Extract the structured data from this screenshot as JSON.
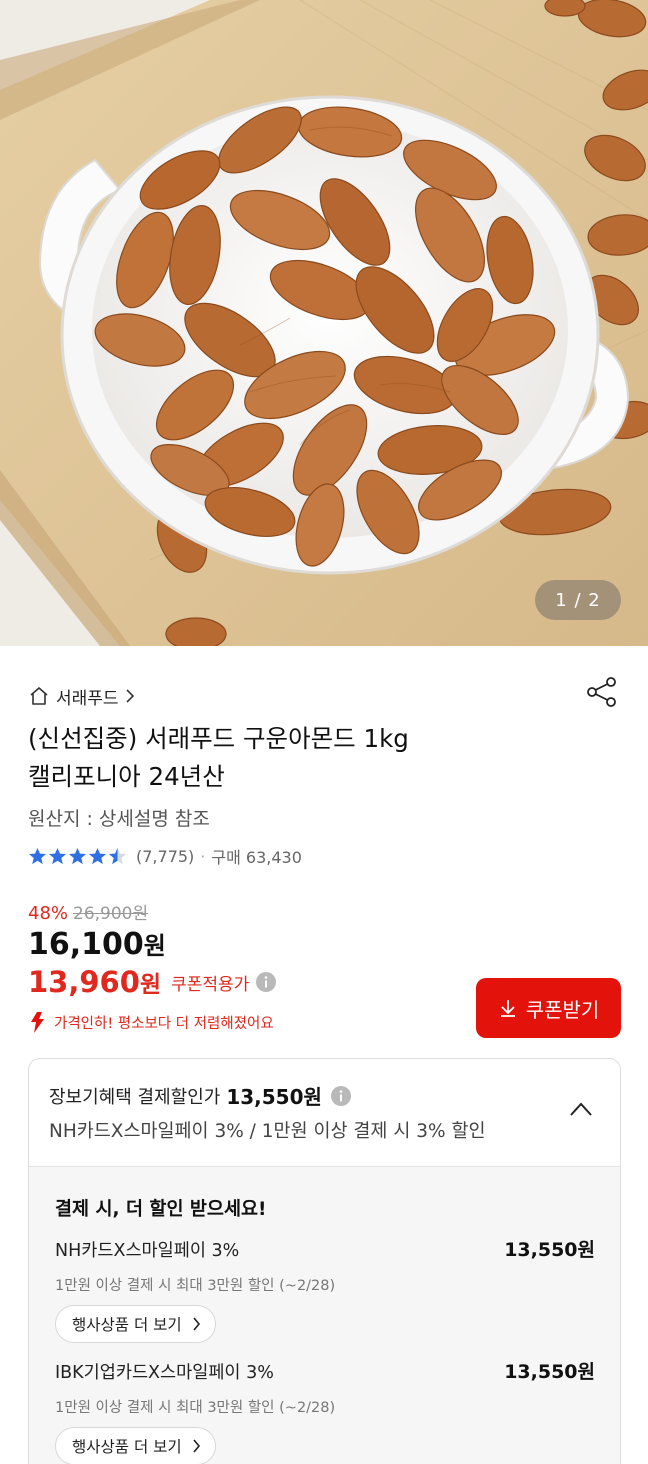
{
  "gallery": {
    "page_indicator": "1 / 2"
  },
  "product": {
    "seller": "서래푸드",
    "title_line1": "(신선집중) 서래푸드 구운아몬드 1kg",
    "title_line2": "캘리포니아 24년산",
    "origin": "원산지 : 상세설명 참조",
    "rating": 4.5,
    "review_count": "(7,775)",
    "purchase_count": "구매 63,430"
  },
  "pricing": {
    "discount_rate": "48%",
    "original_price": "26,900원",
    "sale_price_number": "16,100",
    "sale_price_unit": "원",
    "coupon_price_number": "13,960",
    "coupon_price_unit": "원",
    "coupon_label": "쿠폰적용가",
    "price_drop_notice": "가격인하! 평소보다 더 저렴해졌어요",
    "coupon_button_label": "쿠폰받기"
  },
  "benefits": {
    "header_label": "장보기혜택 결제할인가",
    "header_price": "13,550원",
    "header_desc": "NH카드X스마일페이 3% / 1만원 이상 결제 시 3% 할인",
    "body_title": "결제 시, 더 할인 받으세요!",
    "cards": [
      {
        "name": "NH카드X스마일페이 3%",
        "amount": "13,550원",
        "desc": "1만원 이상 결제 시 최대 3만원 할인 (~2/28)",
        "more_label": "행사상품 더 보기"
      },
      {
        "name": "IBK기업카드X스마일페이 3%",
        "amount": "13,550원",
        "desc": "1만원 이상 결제 시 최대 3만원 할인 (~2/28)",
        "more_label": "행사상품 더 보기"
      }
    ]
  },
  "colors": {
    "accent_red": "#e3120b",
    "price_red": "#e0281e",
    "star_blue": "#2f6fe4"
  },
  "icons": [
    "home-icon",
    "chevron-right-icon",
    "share-icon",
    "star-icon",
    "info-icon",
    "download-icon",
    "price-down-arrow-icon",
    "chevron-up-icon"
  ]
}
